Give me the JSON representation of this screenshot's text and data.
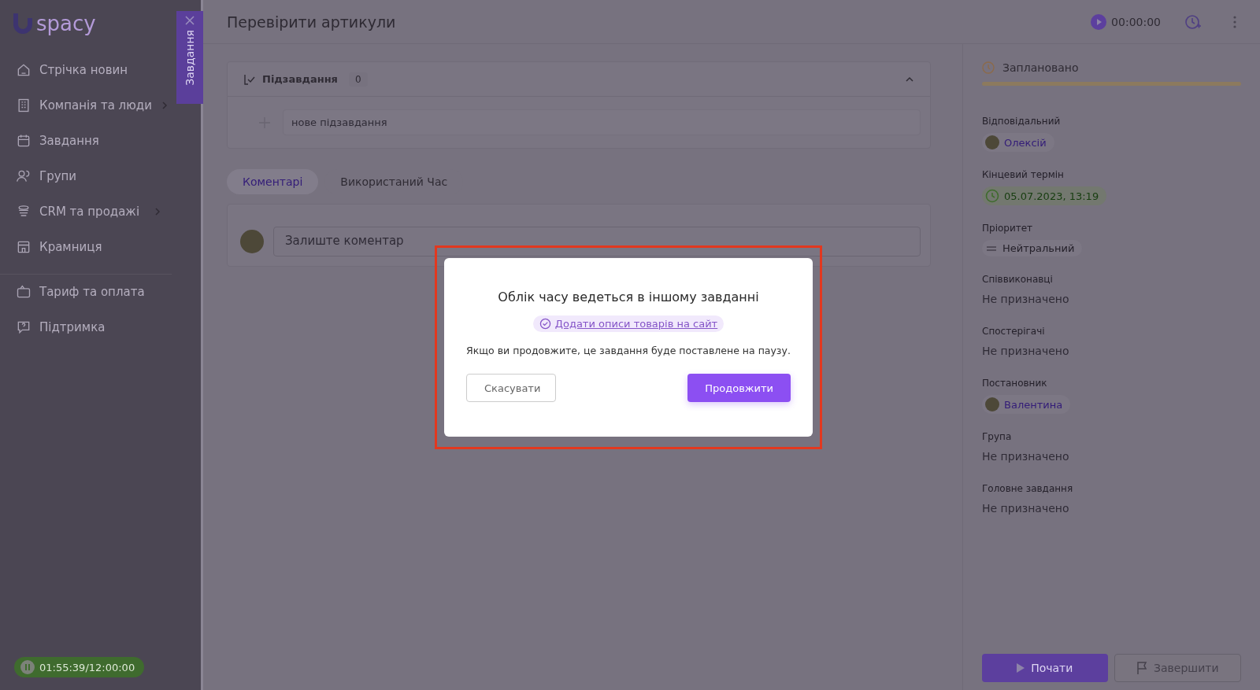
{
  "sidebar": {
    "logo": {
      "text": "spacy"
    },
    "items": [
      {
        "label": "Стрічка новин",
        "has_submenu": false,
        "separated": false
      },
      {
        "label": "Компанія та люди",
        "has_submenu": true,
        "separated": false
      },
      {
        "label": "Завдання",
        "has_submenu": false,
        "separated": false
      },
      {
        "label": "Групи",
        "has_submenu": false,
        "separated": false
      },
      {
        "label": "CRM та продажі",
        "has_submenu": true,
        "separated": false
      },
      {
        "label": "Крамниця",
        "has_submenu": false,
        "separated": false
      },
      {
        "label": "Тариф та оплата",
        "has_submenu": false,
        "separated": true
      },
      {
        "label": "Підтримка",
        "has_submenu": false,
        "separated": false
      }
    ],
    "timer": "01:55:39/12:00:00"
  },
  "side_tab": {
    "label": "Завдання"
  },
  "header": {
    "title": "Перевірити артикули",
    "timer": "00:00:00"
  },
  "subtasks": {
    "label": "Підзавдання",
    "count": "0",
    "expanded": true,
    "placeholder": "нове підзавдання"
  },
  "tabs": [
    {
      "label": "Коментарі",
      "selected": true
    },
    {
      "label": "Використаний Час",
      "selected": false
    }
  ],
  "comment": {
    "placeholder": "Залиште коментар"
  },
  "details": {
    "status": "Заплановано",
    "fields": [
      {
        "label": "Відповідальний",
        "kind": "person",
        "value": "Олексій"
      },
      {
        "label": "Кінцевий термін",
        "kind": "date",
        "value": "05.07.2023, 13:19"
      },
      {
        "label": "Пріоритет",
        "kind": "priority",
        "value": "Нейтральний"
      },
      {
        "label": "Співвиконавці",
        "kind": "empty",
        "value": "Не призначено"
      },
      {
        "label": "Спостерігачі",
        "kind": "empty",
        "value": "Не призначено"
      },
      {
        "label": "Постановник",
        "kind": "person",
        "value": "Валентина"
      },
      {
        "label": "Група",
        "kind": "empty",
        "value": "Не призначено"
      },
      {
        "label": "Головне завдання",
        "kind": "empty",
        "value": "Не призначено"
      }
    ],
    "buttons": [
      {
        "label": "Почати",
        "kind": "start"
      },
      {
        "label": "Завершити",
        "kind": "finish"
      }
    ]
  },
  "modal": {
    "title": "Облік часу ведеться в іншому завданні",
    "task_link": "Додати описи товарів на сайт",
    "message": "Якщо ви продовжите, це завдання буде поставлене на паузу.",
    "buttons": [
      {
        "label": "Скасувати",
        "kind": "secondary"
      },
      {
        "label": "Продовжити",
        "kind": "primary"
      }
    ],
    "highlighted": true
  }
}
